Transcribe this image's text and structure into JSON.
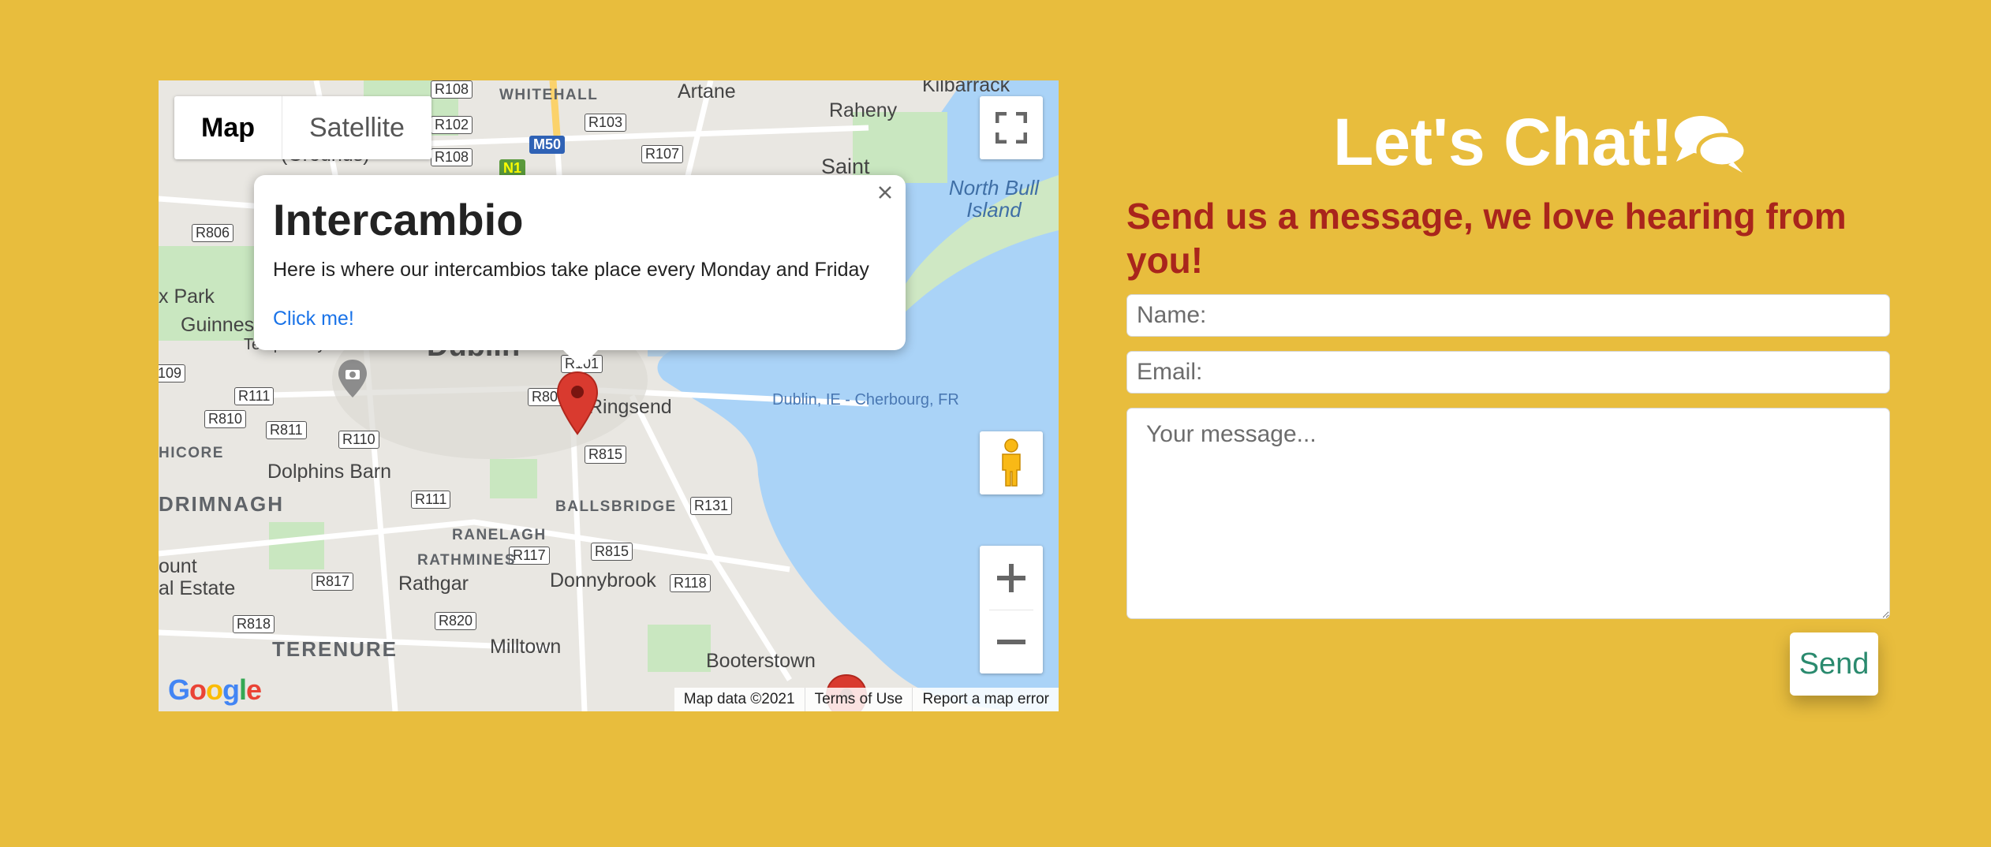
{
  "map": {
    "type_options": [
      "Map",
      "Satellite"
    ],
    "active_type": "Map",
    "road_labels": [
      "R108",
      "R102",
      "R108",
      "R103",
      "R107",
      "R806",
      "R101",
      "R802",
      "R111",
      "R810",
      "R811",
      "R110",
      "R111",
      "R815",
      "R131",
      "R117",
      "R815",
      "R817",
      "R118",
      "R818",
      "R820",
      "109"
    ],
    "place_labels": [
      "WHITEHALL",
      "Artane",
      "Raheny",
      "Kilbarrack",
      "Saint",
      "North Bull Island",
      "x Park",
      "Guinness",
      "Temporarily closed",
      "Dublin",
      "Ringsend",
      "Dublin, IE - Cherbourg, FR",
      "HICORE",
      "Dolphins Barn",
      "DRIMNAGH",
      "RANELAGH",
      "BALLSBRIDGE",
      "RATHMINES",
      "Rathgar",
      "Donnybrook",
      "TERENURE",
      "Milltown",
      "Booterstown",
      "ount",
      "al Estate",
      "(Grounds)"
    ],
    "shields": [
      "M50",
      "N1"
    ],
    "infowindow": {
      "title": "Intercambio",
      "description": "Here is where our intercambios take place every Monday and Friday",
      "link": "Click me!"
    },
    "attribution": {
      "data": "Map data ©2021",
      "terms": "Terms of Use",
      "report": "Report a map error"
    },
    "logo": "Google",
    "colors": {
      "water": "#aad3f7",
      "land": "#e9e7e2",
      "park": "#c9e7c0",
      "marker": "#d93a2f"
    }
  },
  "contact": {
    "title": "Let's Chat!",
    "title_icon": "comments-icon",
    "subtitle": "Send us a message, we love hearing from you!",
    "name_placeholder": "Name:",
    "email_placeholder": "Email:",
    "message_placeholder": "Your message...",
    "send_label": "Send",
    "colors": {
      "background": "#e8bd3d",
      "subtitle": "#a9251c",
      "send_text": "#2a8a6e"
    }
  }
}
